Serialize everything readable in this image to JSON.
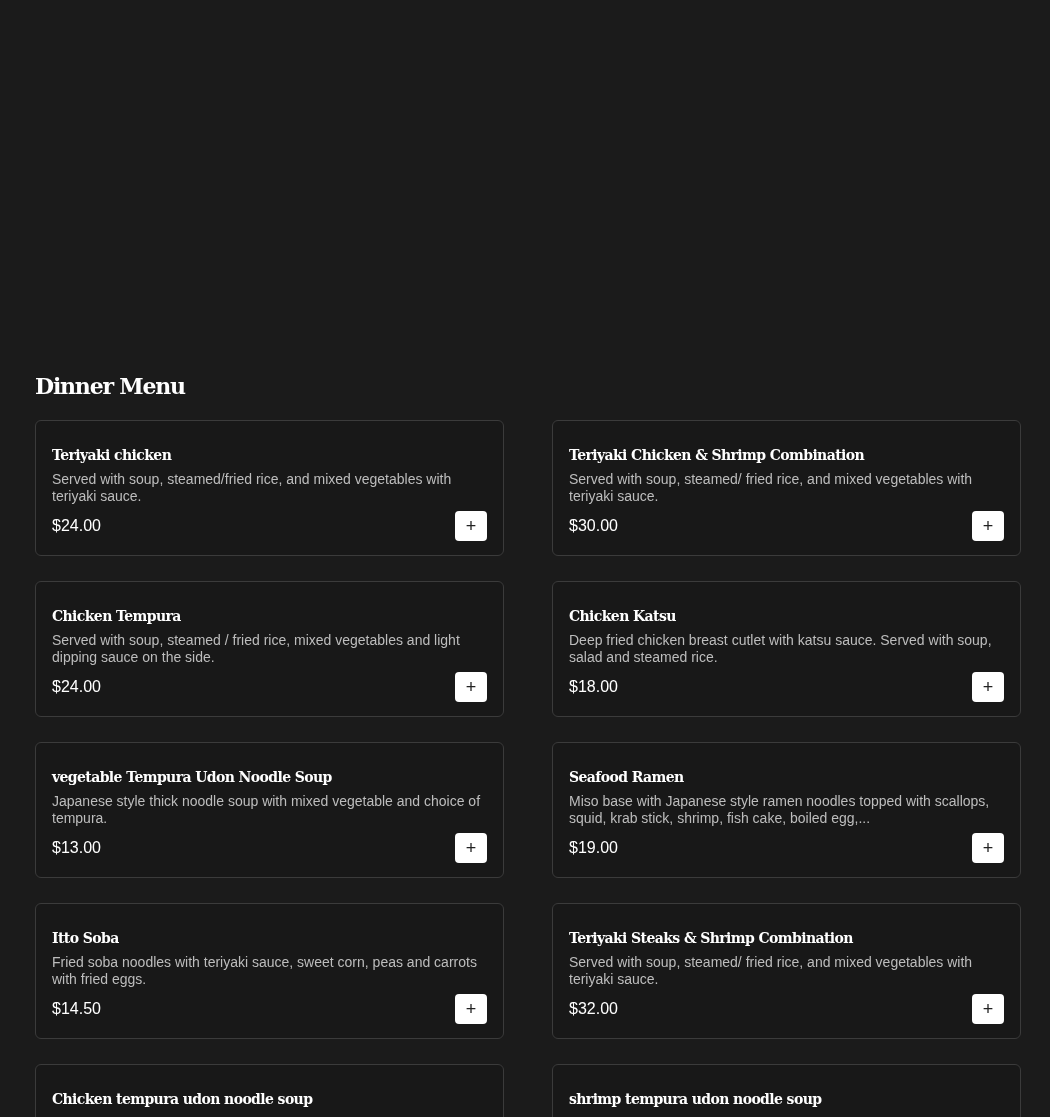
{
  "section": {
    "title": "Dinner Menu"
  },
  "items": [
    {
      "name": "Teriyaki chicken",
      "description": "Served with soup, steamed/fried rice, and mixed vegetables with teriyaki sauce.",
      "price": "$24.00",
      "add": "+"
    },
    {
      "name": "Teriyaki Chicken & Shrimp Combination",
      "description": "Served with soup, steamed/ fried rice, and mixed vegetables with teriyaki sauce.",
      "price": "$30.00",
      "add": "+"
    },
    {
      "name": "Chicken Tempura",
      "description": "Served with soup, steamed / fried rice, mixed vegetables and light dipping sauce on the side.",
      "price": "$24.00",
      "add": "+"
    },
    {
      "name": "Chicken Katsu",
      "description": "Deep fried chicken breast cutlet with katsu sauce. Served with soup, salad and steamed rice.",
      "price": "$18.00",
      "add": "+"
    },
    {
      "name": "vegetable Tempura Udon Noodle Soup",
      "description": "Japanese style thick noodle soup with mixed vegetable and choice of tempura.",
      "price": "$13.00",
      "add": "+"
    },
    {
      "name": "Seafood Ramen",
      "description": "Miso base with Japanese style ramen noodles topped with scallops, squid, krab stick, shrimp, fish cake, boiled egg,...",
      "price": "$19.00",
      "add": "+"
    },
    {
      "name": "Itto Soba",
      "description": "Fried soba noodles with teriyaki sauce, sweet corn, peas and carrots with fried eggs.",
      "price": "$14.50",
      "add": "+"
    },
    {
      "name": "Teriyaki Steaks & Shrimp Combination",
      "description": "Served with soup, steamed/ fried rice, and mixed vegetables with teriyaki sauce.",
      "price": "$32.00",
      "add": "+"
    },
    {
      "name": "Chicken tempura udon noodle soup"
    },
    {
      "name": "shrimp tempura udon noodle soup"
    }
  ]
}
